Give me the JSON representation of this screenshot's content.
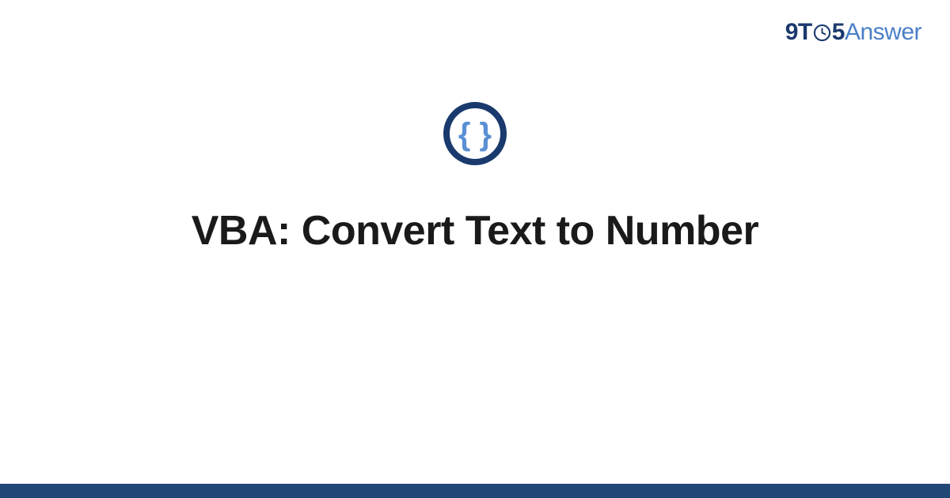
{
  "header": {
    "logo": {
      "part1": "9T",
      "part2": "5",
      "part3": "Answer"
    }
  },
  "main": {
    "title": "VBA: Convert Text to Number"
  },
  "colors": {
    "dark_blue": "#1a3a6e",
    "light_blue": "#4a7fc7",
    "footer_bar": "#1f4876",
    "icon_ring": "#1a3a6e",
    "icon_braces": "#5b8fd4"
  }
}
